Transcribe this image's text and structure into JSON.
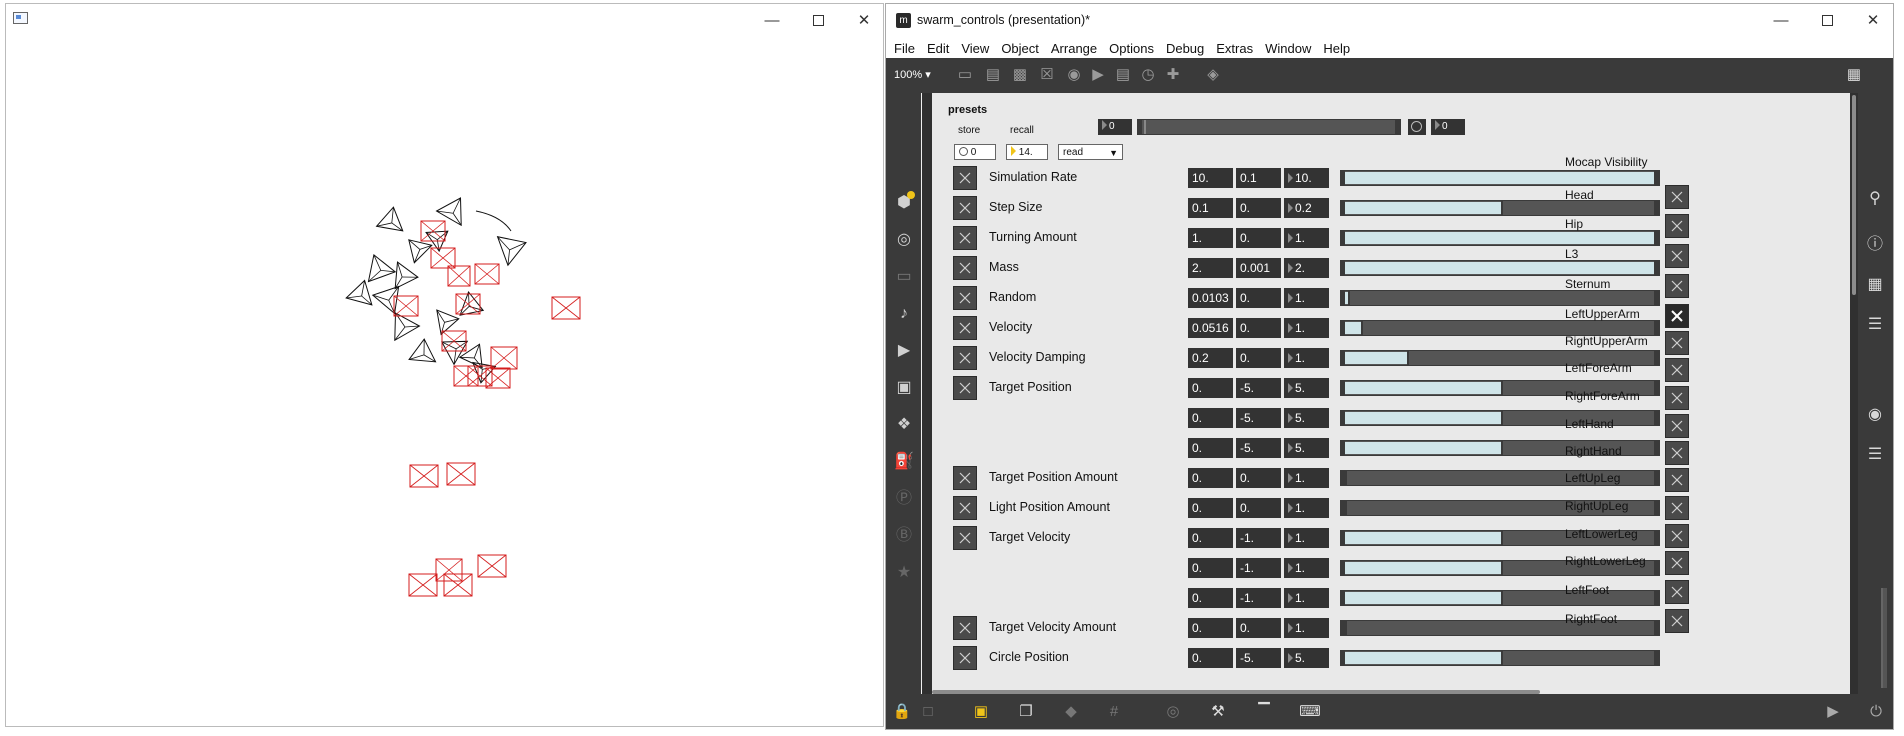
{
  "render_window": {
    "icon": "app-window-icon",
    "controls": [
      "minimize-icon",
      "maximize-icon",
      "close-icon"
    ],
    "colors": {
      "black_shapes": "#111111",
      "red_shapes": "#d41c1c"
    }
  },
  "max_window": {
    "title": "swarm_controls (presentation)*",
    "menu": [
      "File",
      "Edit",
      "View",
      "Object",
      "Arrange",
      "Options",
      "Debug",
      "Extras",
      "Window",
      "Help"
    ],
    "zoom": "100%",
    "presets": {
      "title": "presets",
      "store_label": "store",
      "recall_label": "recall",
      "store_value": "0",
      "recall_value": "14.",
      "read_menu": "read",
      "top_number_left": "0",
      "top_number_right": "0"
    },
    "params": [
      {
        "label": "Simulation Rate",
        "value": "10.",
        "min": "0.1",
        "max": "10.",
        "slider": 1.0
      },
      {
        "label": "Step Size",
        "value": "0.1",
        "min": "0.",
        "max": "0.2",
        "slider": 0.5
      },
      {
        "label": "Turning Amount",
        "value": "1.",
        "min": "0.",
        "max": "1.",
        "slider": 1.0
      },
      {
        "label": "Mass",
        "value": "2.",
        "min": "0.001",
        "max": "2.",
        "slider": 1.0
      },
      {
        "label": "Random",
        "value": "0.0103",
        "min": "0.",
        "max": "1.",
        "slider": 0.01
      },
      {
        "label": "Velocity",
        "value": "0.0516",
        "min": "0.",
        "max": "1.",
        "slider": 0.05
      },
      {
        "label": "Velocity Damping",
        "value": "0.2",
        "min": "0.",
        "max": "1.",
        "slider": 0.2
      },
      {
        "label": "Target Position",
        "value": "0.",
        "min": "-5.",
        "max": "5.",
        "slider": 0.5
      },
      {
        "label": "",
        "value": "0.",
        "min": "-5.",
        "max": "5.",
        "slider": 0.5
      },
      {
        "label": "",
        "value": "0.",
        "min": "-5.",
        "max": "5.",
        "slider": 0.5
      },
      {
        "label": "Target Position Amount",
        "value": "0.",
        "min": "0.",
        "max": "1.",
        "slider": 0.0
      },
      {
        "label": "Light Position Amount",
        "value": "0.",
        "min": "0.",
        "max": "1.",
        "slider": 0.0
      },
      {
        "label": "Target Velocity",
        "value": "0.",
        "min": "-1.",
        "max": "1.",
        "slider": 0.5
      },
      {
        "label": "",
        "value": "0.",
        "min": "-1.",
        "max": "1.",
        "slider": 0.5
      },
      {
        "label": "",
        "value": "0.",
        "min": "-1.",
        "max": "1.",
        "slider": 0.5
      },
      {
        "label": "Target Velocity Amount",
        "value": "0.",
        "min": "0.",
        "max": "1.",
        "slider": 0.0
      },
      {
        "label": "Circle Position",
        "value": "0.",
        "min": "-5.",
        "max": "5.",
        "slider": 0.5
      }
    ],
    "mocap": {
      "title": "Mocap Visibility",
      "items": [
        "Head",
        "Hip",
        "L3",
        "Sternum",
        "LeftUpperArm",
        "RightUpperArm",
        "LeftForeArm",
        "RightForeArm",
        "LeftHand",
        "RightHand",
        "LeftUpLeg",
        "RightUpLeg",
        "LeftLowerLeg",
        "RightLowerLeg",
        "LeftFoot",
        "RightFoot"
      ],
      "checked_index": 4
    },
    "colors": {
      "accent": "#f0c419",
      "slider_fill": "#cfe4e8",
      "toolbar": "#3a3a3a"
    }
  }
}
